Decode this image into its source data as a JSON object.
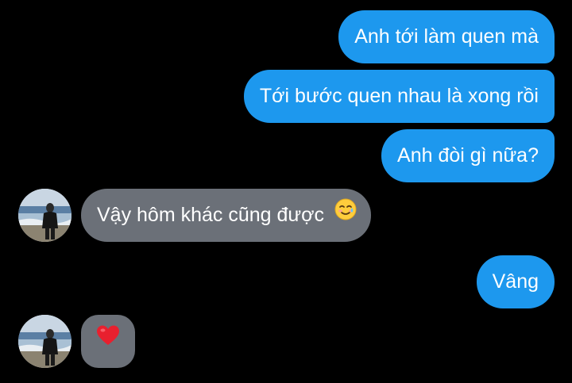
{
  "conversation": {
    "messages": [
      {
        "sender": "me",
        "text": "Anh tới làm quen mà"
      },
      {
        "sender": "me",
        "text": "Tới bước quen nhau là xong rồi"
      },
      {
        "sender": "me",
        "text": "Anh đòi gì nữa?"
      },
      {
        "sender": "them",
        "text": "Vậy hôm khác cũng được",
        "emoji": "smiling-face-with-tear-icon"
      },
      {
        "sender": "me",
        "text": "Vâng"
      },
      {
        "sender": "them",
        "emoji": "red-heart-icon"
      }
    ]
  },
  "colors": {
    "background": "#000000",
    "outgoing_bubble": "#1d98ee",
    "incoming_bubble": "#6b7078",
    "text": "#ffffff"
  }
}
